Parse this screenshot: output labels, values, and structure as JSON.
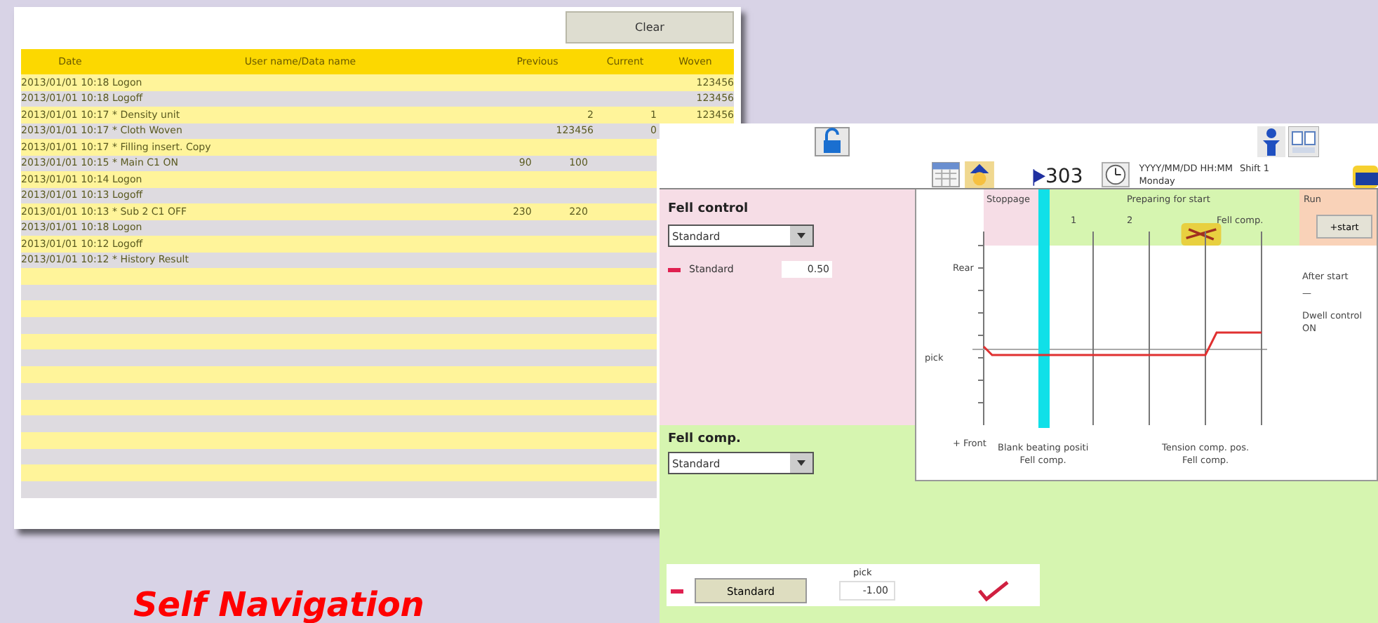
{
  "log_window": {
    "clear_button": "Clear",
    "columns": [
      "Date",
      "User name/Data name",
      "Previous",
      "Current",
      "Woven"
    ],
    "rows": [
      {
        "entry": "2013/01/01 10:18 Logon",
        "previous": "",
        "current": "",
        "woven": "123456"
      },
      {
        "entry": "2013/01/01 10:18 Logoff",
        "previous": "",
        "current": "",
        "woven": "123456"
      },
      {
        "entry": "2013/01/01 10:17 * Density unit",
        "previous": "2",
        "current": "1",
        "woven": "123456"
      },
      {
        "entry": "2013/01/01 10:17 * Cloth Woven",
        "previous": "123456",
        "current": "0",
        "woven": ""
      },
      {
        "entry": "2013/01/01 10:17 * Filling insert. Copy",
        "previous": "",
        "current": "",
        "woven": ""
      },
      {
        "entry": "2013/01/01 10:15 * Main C1 ON",
        "previous": "90",
        "current": "100",
        "woven": ""
      },
      {
        "entry": "2013/01/01 10:14 Logon",
        "previous": "",
        "current": "",
        "woven": ""
      },
      {
        "entry": "2013/01/01 10:13 Logoff",
        "previous": "",
        "current": "",
        "woven": ""
      },
      {
        "entry": "2013/01/01 10:13 * Sub 2 C1 OFF",
        "previous": "230",
        "current": "220",
        "woven": ""
      },
      {
        "entry": "2013/01/01 10:18 Logon",
        "previous": "",
        "current": "",
        "woven": ""
      },
      {
        "entry": "2013/01/01 10:12 Logoff",
        "previous": "",
        "current": "",
        "woven": ""
      },
      {
        "entry": "2013/01/01 10:12 * History Result",
        "previous": "",
        "current": "",
        "woven": ""
      }
    ]
  },
  "fell_window": {
    "toolbar": {
      "counter": "303",
      "date_format": "YYYY/MM/DD HH:MM",
      "weekday": "Monday",
      "shift": "Shift 1"
    },
    "fell_control": {
      "title": "Fell control",
      "dropdown": "Standard",
      "setting_label": "Standard",
      "setting_value": "0.50"
    },
    "fell_comp": {
      "title": "Fell comp.",
      "dropdown": "Standard",
      "column_header": "pick",
      "button": "Standard",
      "value": "-1.00"
    },
    "chart": {
      "phases": [
        {
          "label": "Stoppage",
          "kind": "stoppage"
        },
        {
          "label": "Preparing for start",
          "kind": "prepare"
        },
        {
          "label": "Run",
          "kind": "run"
        }
      ],
      "steps": [
        "1",
        "2"
      ],
      "step_label": "Fell comp.",
      "start_button": "+start",
      "axis_labels": [
        "Rear",
        "pick",
        "+ Front"
      ],
      "markers": [
        {
          "line1": "Blank beating positi",
          "line2": "Fell comp."
        },
        {
          "line1": "Tension comp. pos.",
          "line2": "Fell comp."
        }
      ],
      "after_start": "After start",
      "after_value": "—",
      "dwell": "Dwell control ON"
    }
  },
  "caption": "Self Navigation"
}
